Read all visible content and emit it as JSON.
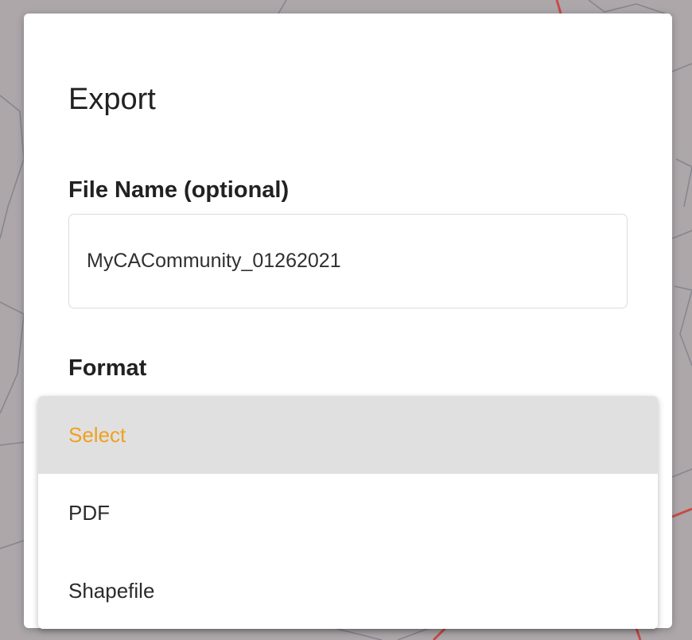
{
  "background": {
    "map_road_color": "#e0241a",
    "overlay_color": "#8c8287"
  },
  "dialog": {
    "title": "Export",
    "file_name": {
      "label": "File Name (optional)",
      "value": "MyCACommunity_01262021"
    },
    "format": {
      "label": "Format",
      "options": [
        {
          "label": "Select",
          "selected": true
        },
        {
          "label": "PDF",
          "selected": false
        },
        {
          "label": "Shapefile",
          "selected": false
        }
      ]
    }
  },
  "colors": {
    "selected_option_text": "#f0a020",
    "selected_option_bg": "#e0e0e0"
  }
}
